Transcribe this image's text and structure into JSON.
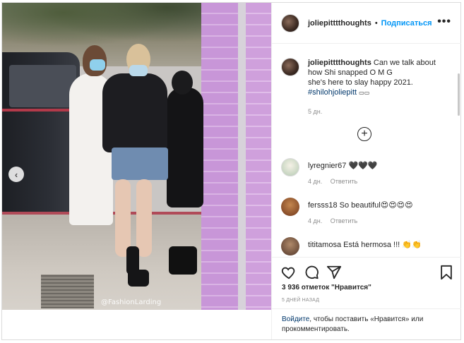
{
  "header": {
    "username": "joliepitttthoughts",
    "separator": "•",
    "follow_label": "Подписаться",
    "more_label": "•••"
  },
  "caption": {
    "username": "joliepitttthoughts",
    "text_line1": "Can we talk about how Shi snapped O M G",
    "text_line2": "she's here to slay happy 2021.",
    "hashtag": "#shilohjoliepitt",
    "emoji_placeholder": "▭▭",
    "time": "5 дн."
  },
  "load_more_label": "+",
  "comments": [
    {
      "username": "lyregnier67",
      "text": "🖤🖤🖤",
      "time": "4 дн.",
      "reply_label": "Ответить"
    },
    {
      "username": "fersss18",
      "text": "So beautiful😍😍😍😍",
      "time": "4 дн.",
      "reply_label": "Ответить"
    },
    {
      "username": "tititamosa",
      "text": "Está hermosa !!! 👏👏",
      "time": "",
      "reply_label": ""
    }
  ],
  "likes_text": "3 936 отметок \"Нравится\"",
  "post_date": "5 ДНЕЙ НАЗАД",
  "login_prompt": {
    "link": "Войдите",
    "text": ", чтобы поставить «Нравится» или прокомментировать."
  },
  "photo": {
    "watermark": "@FashionLarding",
    "prev_arrow": "‹"
  },
  "icons": [
    "heart-icon",
    "comment-icon",
    "share-icon",
    "bookmark-icon",
    "plus-circle-icon",
    "chevron-left-icon",
    "more-icon"
  ]
}
